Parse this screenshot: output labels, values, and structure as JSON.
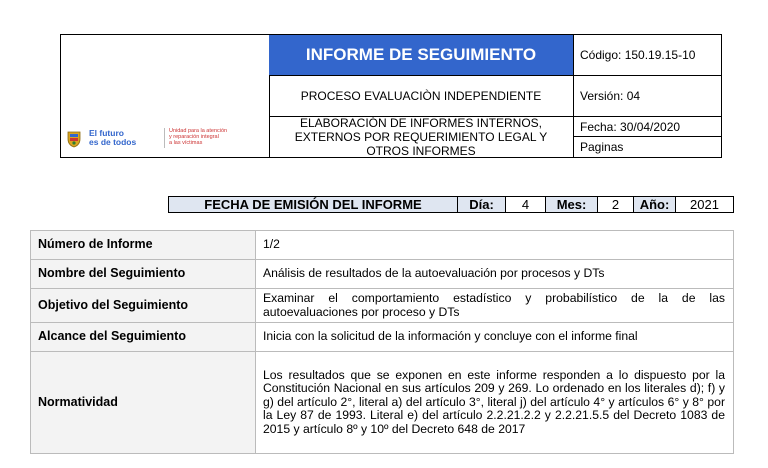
{
  "header": {
    "title": "INFORME DE SEGUIMIENTO",
    "process": "PROCESO EVALUACIÒN INDEPENDIENTE",
    "procedure": "ELABORACIÓN DE INFORMES INTERNOS, EXTERNOS POR REQUERIMIENTO LEGAL Y OTROS INFORMES",
    "code": "Código: 150.19.15-10",
    "version": "Versión: 04",
    "date": "Fecha: 30/04/2020",
    "pages": "Paginas",
    "logo": {
      "slogan_line1": "El futuro",
      "slogan_line2": "es de todos",
      "unit_line1": "Unidad para la atención",
      "unit_line2": "y reparación integral",
      "unit_line3": "a las víctimas",
      "accent": "#3366cc"
    }
  },
  "emission": {
    "label": "FECHA DE EMISIÓN DEL INFORME",
    "day_label": "Día:",
    "day": "4",
    "month_label": "Mes:",
    "month": "2",
    "year_label": "Año:",
    "year": "2021"
  },
  "rows": [
    {
      "key": "Número de Informe",
      "value": "1/2"
    },
    {
      "key": "Nombre del Seguimiento",
      "value": "Análisis de resultados de la autoevaluación por procesos y DTs"
    },
    {
      "key": "Objetivo del Seguimiento",
      "value": "Examinar el comportamiento estadístico y probabilístico de la de las autoevaluaciones por proceso y DTs"
    },
    {
      "key": "Alcance del Seguimiento",
      "value": "Inicia con la solicitud de la información y concluye con el informe final"
    },
    {
      "key": "Normatividad",
      "value": "Los resultados que se exponen en este informe responden a lo dispuesto por la Constitución Nacional en sus artículos 209 y 269. Lo ordenado en los literales d); f) y g) del artículo 2°, literal a) del artículo 3°, literal j) del artículo 4° y artículos 6° y 8° por la Ley 87 de 1993. Literal e) del artículo 2.2.21.2.2 y 2.2.21.5.5 del Decreto 1083 de 2015 y artículo 8º y 10º del Decreto 648 de 2017"
    }
  ]
}
